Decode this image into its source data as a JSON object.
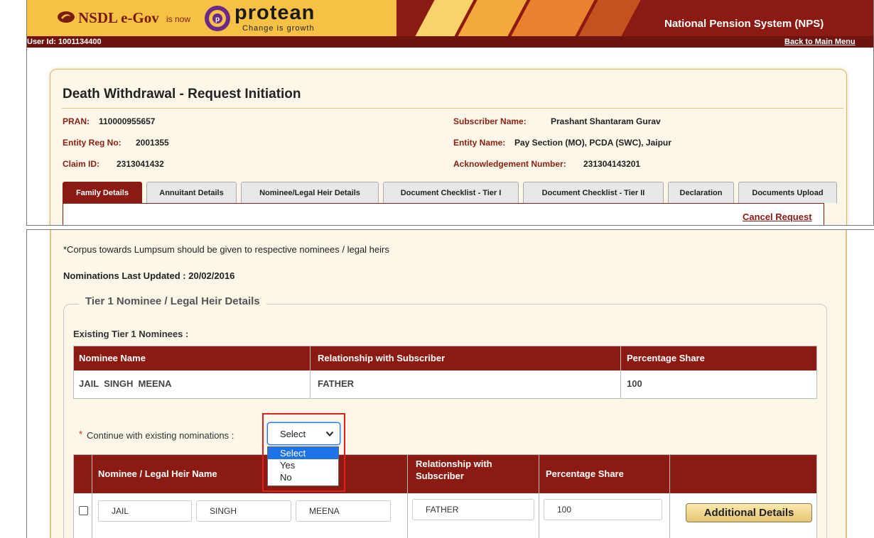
{
  "header": {
    "logo_nsdl": "NSDL e-Gov",
    "logo_isnow": "is now",
    "logo_protean": "protean",
    "logo_tagline": "Change is growth",
    "system_title": "National Pension System (NPS)"
  },
  "userbar": {
    "user_id": "User Id: 1001134400",
    "back_link": "Back to Main Menu"
  },
  "page_title": "Death Withdrawal - Request Initiation",
  "info": {
    "pran_label": "PRAN:",
    "pran_value": "110000955657",
    "subscriber_label": "Subscriber Name:",
    "subscriber_value": "Prashant Shantaram Gurav",
    "entity_reg_label": "Entity Reg No:",
    "entity_reg_value": "2001355",
    "entity_name_label": "Entity Name:",
    "entity_name_value": "Pay Section (MO), PCDA (SWC), Jaipur",
    "claim_label": "Claim ID:",
    "claim_value": "2313041432",
    "ack_label": "Acknowledgement Number:",
    "ack_value": "231304143201"
  },
  "tabs": [
    {
      "label": "Family Details",
      "active": true
    },
    {
      "label": "Annuitant Details"
    },
    {
      "label": "Nominee/Legal Heir Details"
    },
    {
      "label": "Document Checklist - Tier I"
    },
    {
      "label": "Document Checklist - Tier II"
    },
    {
      "label": "Declaration"
    },
    {
      "label": "Documents Upload"
    }
  ],
  "cancel_request": "Cancel Request",
  "corpus_note": "*Corpus towards Lumpsum should be given to respective nominees / legal heirs",
  "nominations_updated": "Nominations Last Updated : 20/02/2016",
  "legend": "Tier 1 Nominee / Legal Heir Details",
  "existing_title": "Existing Tier 1 Nominees :",
  "existing_table": {
    "headers": [
      "Nominee Name",
      "Relationship with Subscriber",
      "Percentage Share"
    ],
    "row": [
      "JAIL  SINGH  MEENA",
      "FATHER",
      "100"
    ]
  },
  "continue": {
    "asterisk": "*",
    "label": "Continue with existing nominations :",
    "selected": "Select",
    "options": [
      "Select",
      "Yes",
      "No"
    ]
  },
  "nominee_table": {
    "headers": [
      "Nominee / Legal Heir Name",
      "Relationship with Subscriber",
      "Percentage Share"
    ],
    "first_name": "JAIL",
    "middle_name": "SINGH",
    "last_name": "MEENA",
    "relationship": "FATHER",
    "percentage": "100",
    "details_button": "Additional Details"
  },
  "colors": {
    "maroon": "#8b1a12",
    "gold": "#f6c145",
    "cream": "#fdf7e9",
    "highlight_red": "#e02020",
    "select_blue": "#1e73e8"
  }
}
